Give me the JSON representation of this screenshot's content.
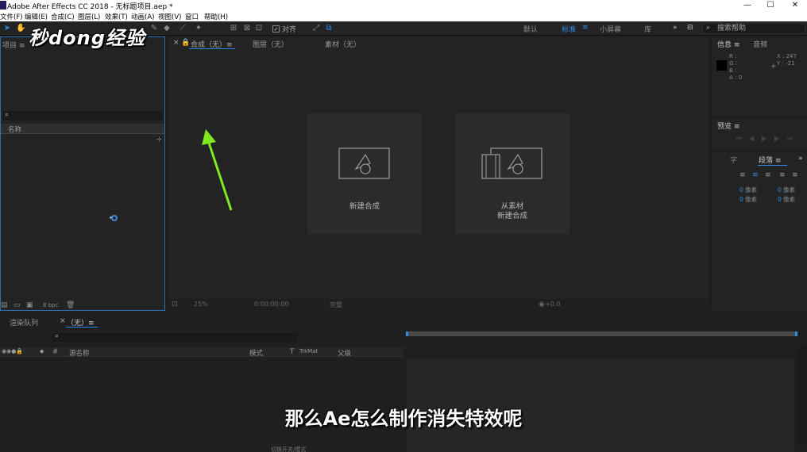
{
  "window": {
    "title": "Adobe After Effects CC 2018 - 无标题项目.aep *",
    "minimize": "—",
    "maximize": "☐",
    "close": "✕"
  },
  "menu": [
    "文件(F)",
    "编辑(E)",
    "合成(C)",
    "图层(L)",
    "效果(T)",
    "动画(A)",
    "视图(V)",
    "窗口",
    "帮助(H)"
  ],
  "toolbar": {
    "snap_label": "对齐",
    "workspaces": [
      "默认",
      "标准",
      "小屏幕",
      "库"
    ],
    "active_workspace": "标准",
    "search_placeholder": "搜索帮助"
  },
  "watermark": "秒dong经验",
  "project_panel": {
    "tab": "项目 ≡",
    "name_column": "名称",
    "bpc": "8 bpc"
  },
  "composition_panel": {
    "tabs": [
      "合成（无）≡",
      "图层（无）",
      "素材（无）"
    ],
    "new_comp_label": "新建合成",
    "from_footage_line1": "从素材",
    "from_footage_line2": "新建合成",
    "zoom": "25%",
    "timecode": "0:00:00:00",
    "quality": "完整",
    "exposure": "+0.0"
  },
  "info_panel": {
    "tab": "信息 ≡",
    "audio_tab": "音频",
    "r_label": "R :",
    "g_label": "G :",
    "b_label": "B :",
    "a_label": "A : 0",
    "x_label": "X : 247",
    "y_label": "Y : -21"
  },
  "preview_panel": {
    "tab": "预览 ≡"
  },
  "paragraph_panel": {
    "tab": "段落 ≡",
    "values": [
      "0 像素",
      "0 像素",
      "0 像素",
      "0 像素",
      "0 像素"
    ]
  },
  "timeline": {
    "render_queue_tab": "渲染队列",
    "comp_tab": "（无）≡",
    "columns": [
      "#",
      "源名称",
      "模式",
      "T",
      "TrkMat",
      "父级"
    ],
    "bottom_label": "切换开关/模式"
  },
  "subtitle": "那么Ae怎么制作消失特效呢",
  "colors": {
    "accent": "#2d8ceb",
    "arrow": "#7fe81e",
    "panel_bg": "#232323",
    "card_bg": "#2b2b2b"
  }
}
